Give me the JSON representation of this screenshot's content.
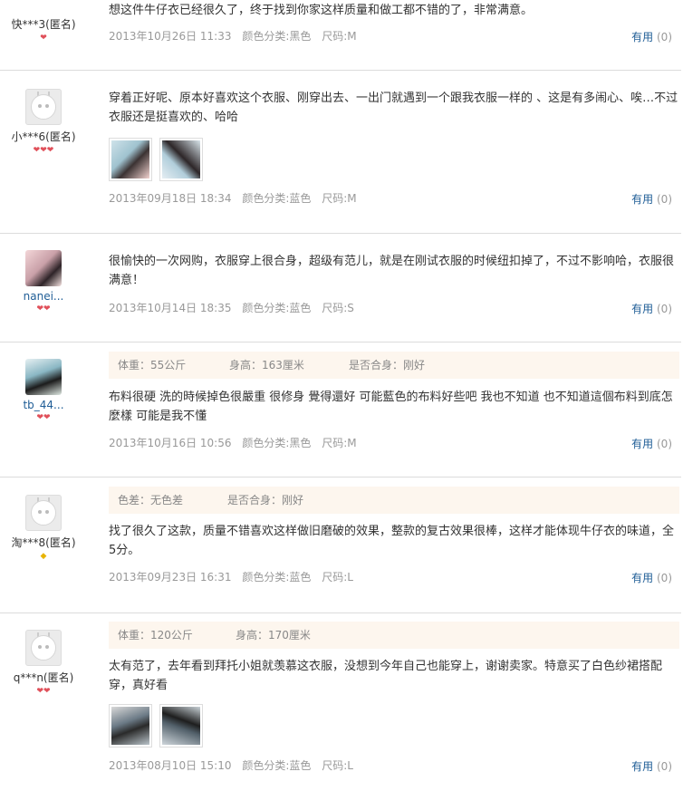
{
  "useful_label": "有用",
  "reviews": [
    {
      "user": "快***3(匿名)",
      "level": "1heart",
      "text": "想这件牛仔衣已经很久了，终于找到你家这样质量和做工都不错的了，非常满意。",
      "date": "2013年10月26日 11:33",
      "color": "颜色分类:黑色",
      "size": "尺码:M",
      "useful_count": "(0)"
    },
    {
      "user": "小***6(匿名)",
      "level": "3heart",
      "text": "穿着正好呢、原本好喜欢这个衣服、刚穿出去、一出门就遇到一个跟我衣服一样的 、这是有多闹心、唉…不过衣服还是挺喜欢的、哈哈",
      "date": "2013年09月18日 18:34",
      "color": "颜色分类:蓝色",
      "size": "尺码:M",
      "useful_count": "(0)"
    },
    {
      "user": "nanei...",
      "level": "2heart",
      "text": "很愉快的一次网购，衣服穿上很合身，超级有范儿，就是在刚试衣服的时候纽扣掉了，不过不影响哈，衣服很满意！",
      "date": "2013年10月14日 18:35",
      "color": "颜色分类:蓝色",
      "size": "尺码:S",
      "useful_count": "(0)"
    },
    {
      "user": "tb_44...",
      "level": "2heart",
      "attrs": {
        "a": "体重：55公斤",
        "b": "身高：163厘米",
        "c": "是否合身：刚好"
      },
      "text": "布料很硬 洗的時候掉色很嚴重 很修身 覺得還好 可能藍色的布料好些吧 我也不知道 也不知道這個布料到底怎麼樣 可能是我不懂",
      "date": "2013年10月16日 10:56",
      "color": "颜色分类:黑色",
      "size": "尺码:M",
      "useful_count": "(0)"
    },
    {
      "user": "淘***8(匿名)",
      "level": "gem",
      "attrs": {
        "a": "色差：无色差",
        "b": "是否合身：刚好"
      },
      "text": "找了很久了这款，质量不错喜欢这样做旧磨破的效果，整款的复古效果很棒，这样才能体现牛仔衣的味道，全5分。",
      "date": "2013年09月23日 16:31",
      "color": "颜色分类:蓝色",
      "size": "尺码:L",
      "useful_count": "(0)"
    },
    {
      "user": "q***n(匿名)",
      "level": "2heart",
      "attrs": {
        "a": "体重：120公斤",
        "b": "身高：170厘米"
      },
      "text": "太有范了，去年看到拜托小姐就羡慕这衣服，没想到今年自己也能穿上，谢谢卖家。特意买了白色纱裙搭配穿，真好看",
      "date": "2013年08月10日 15:10",
      "color": "颜色分类:蓝色",
      "size": "尺码:L",
      "useful_count": "(0)"
    }
  ]
}
